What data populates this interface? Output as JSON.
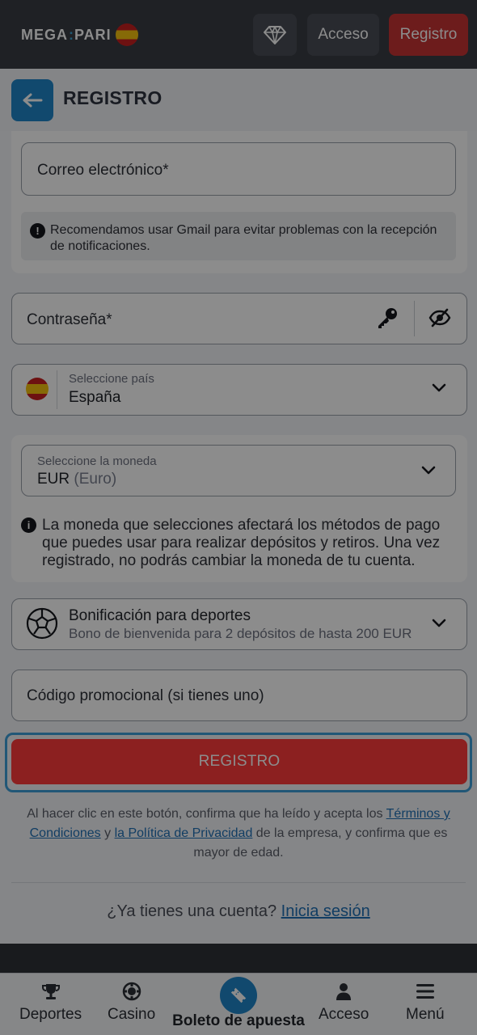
{
  "header": {
    "logo_left": "MEGA",
    "logo_sep": ":",
    "logo_right": "PARI",
    "gem_icon": "diamond-icon",
    "login_label": "Acceso",
    "register_label": "Registro"
  },
  "registration": {
    "title": "REGISTRO",
    "back_icon": "arrow-left-icon"
  },
  "form": {
    "email": {
      "placeholder": "Correo electrónico*"
    },
    "gmail_note": "Recomendamos usar Gmail para evitar problemas con la recepción de notificaciones.",
    "password": {
      "placeholder": "Contraseña*",
      "key_icon": "key-icon",
      "eye_icon": "eye-slash-icon"
    },
    "country": {
      "label": "Seleccione país",
      "value": "España",
      "flag_icon": "spain-flag-icon"
    },
    "currency": {
      "label": "Seleccione la moneda",
      "value_code": "EUR",
      "value_name": "(Euro)"
    },
    "currency_note": "La moneda que selecciones afectará los métodos de pago que puedes usar para realizar depósitos y retiros. Una vez registrado, no podrás cambiar la moneda de tu cuenta.",
    "bonus": {
      "title": "Bonificación para deportes",
      "subtitle": "Bono de bienvenida para 2 depósitos de hasta 200 EUR",
      "icon": "soccer-ball-icon"
    },
    "promo": {
      "placeholder": "Código promocional (si tienes uno)"
    },
    "submit_label": "REGISTRO"
  },
  "legal": {
    "text1": "Al hacer clic en este botón, confirma que ha leído y acepta los ",
    "terms_link": "Términos y Condiciones",
    "text2": " y ",
    "privacy_link": "la Política de Privacidad",
    "text3": " de la empresa, y confirma que es mayor de edad."
  },
  "login_prompt": {
    "text": "¿Ya tienes una cuenta? ",
    "link": "Inicia sesión"
  },
  "bottom_nav": {
    "sports": "Deportes",
    "casino": "Casino",
    "betslip": "Boleto de apuesta",
    "login": "Acceso",
    "menu": "Menú"
  },
  "colors": {
    "accent_blue": "#1f86c9",
    "primary_red": "#ff3b3b",
    "header_dark": "#3a3d44"
  }
}
